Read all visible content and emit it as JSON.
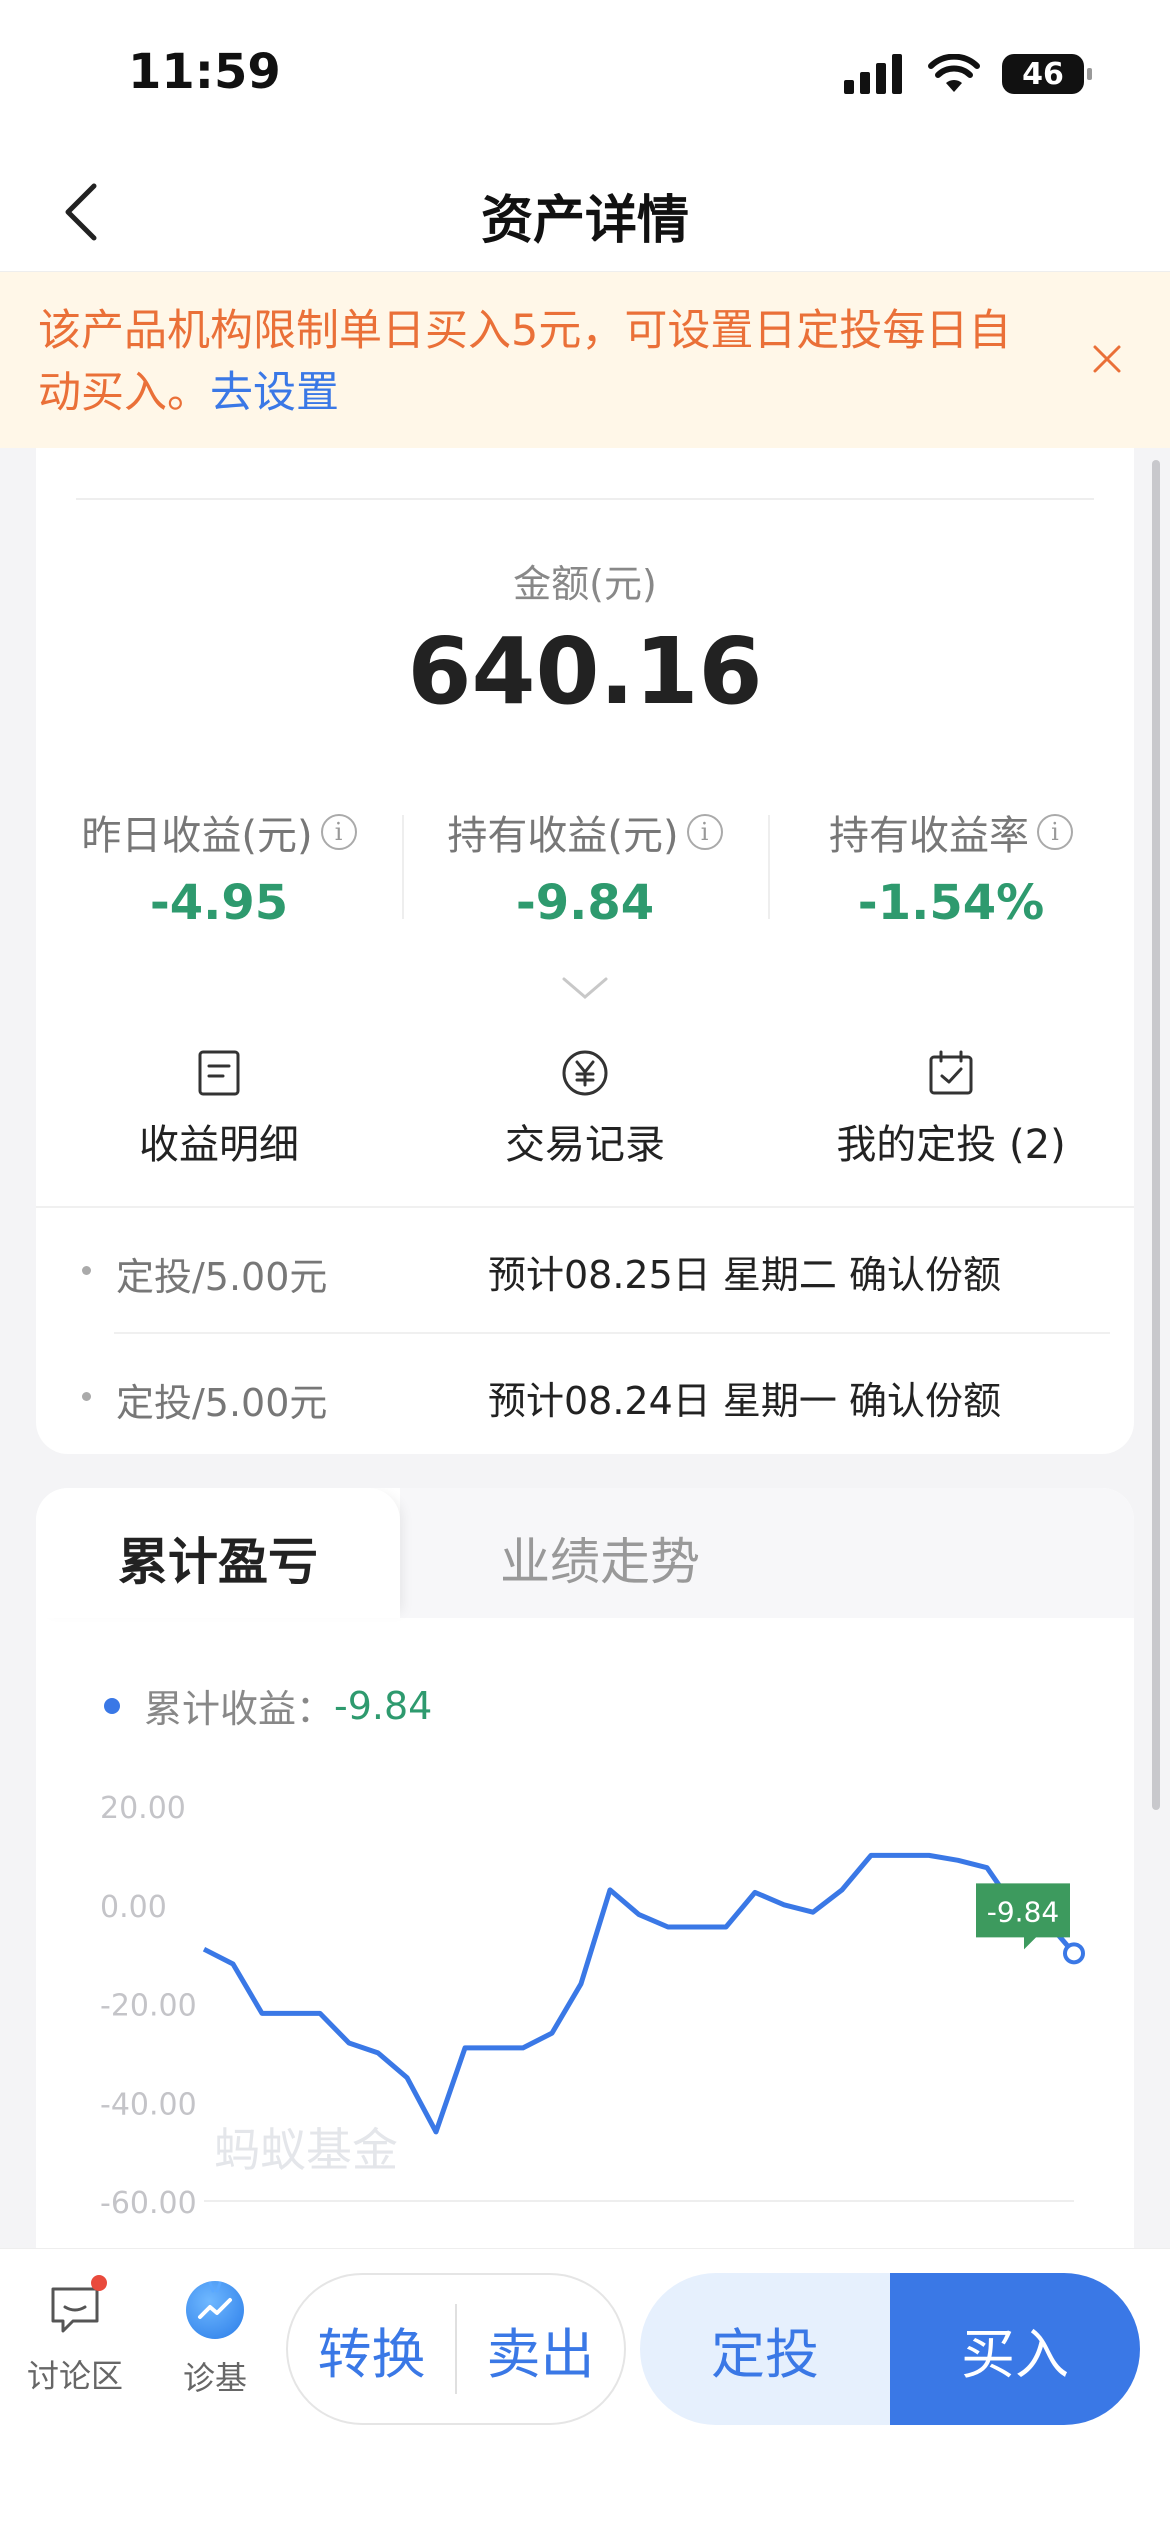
{
  "status_bar": {
    "time": "11:59",
    "battery": "46"
  },
  "nav": {
    "title": "资产详情"
  },
  "notice": {
    "text": "该产品机构限制单日买入5元，可设置日定投每日自动买入。",
    "link": "去设置"
  },
  "summary": {
    "amount_label": "金额(元)",
    "amount_value": "640.16",
    "stats": [
      {
        "label": "昨日收益(元)",
        "value": "-4.95"
      },
      {
        "label": "持有收益(元)",
        "value": "-9.84"
      },
      {
        "label": "持有收益率",
        "value": "-1.54%"
      }
    ]
  },
  "actions": [
    {
      "label": "收益明细",
      "icon": "document-icon"
    },
    {
      "label": "交易记录",
      "icon": "yen-circle-icon"
    },
    {
      "label": "我的定投 (2)",
      "icon": "calendar-check-icon"
    }
  ],
  "plans": [
    {
      "type": "定投/5.00元",
      "desc": "预计08.25日 星期二 确认份额"
    },
    {
      "type": "定投/5.00元",
      "desc": "预计08.24日 星期一 确认份额"
    }
  ],
  "chart_tabs": {
    "active": "累计盈亏",
    "inactive": "业绩走势"
  },
  "legend": {
    "label": "累计收益：",
    "value": "-9.84"
  },
  "watermark": "蚂蚁基金",
  "chart_data": {
    "type": "line",
    "series": [
      {
        "name": "累计收益",
        "values": [
          -9,
          -12,
          -22,
          -22,
          -22,
          -28,
          -30,
          -35,
          -46,
          -29,
          -29,
          -29,
          -26,
          -16,
          3,
          -2,
          -4.5,
          -4.5,
          -4.5,
          2.5,
          0,
          -1.5,
          3,
          10,
          10,
          10,
          9,
          7.5,
          -1,
          -3,
          -9.84
        ]
      }
    ],
    "yticks": [
      "20.00",
      "0.00",
      "-20.00",
      "-40.00",
      "-60.00"
    ],
    "ylim": [
      -60,
      20
    ],
    "end_label": "-9.84",
    "colors": {
      "line": "#3a78e6",
      "end_label_bg": "#3d9a5e"
    }
  },
  "bottom_bar": {
    "discussion": "讨论区",
    "diagnose": "诊基",
    "convert": "转换",
    "sell": "卖出",
    "sip": "定投",
    "buy": "买入"
  }
}
